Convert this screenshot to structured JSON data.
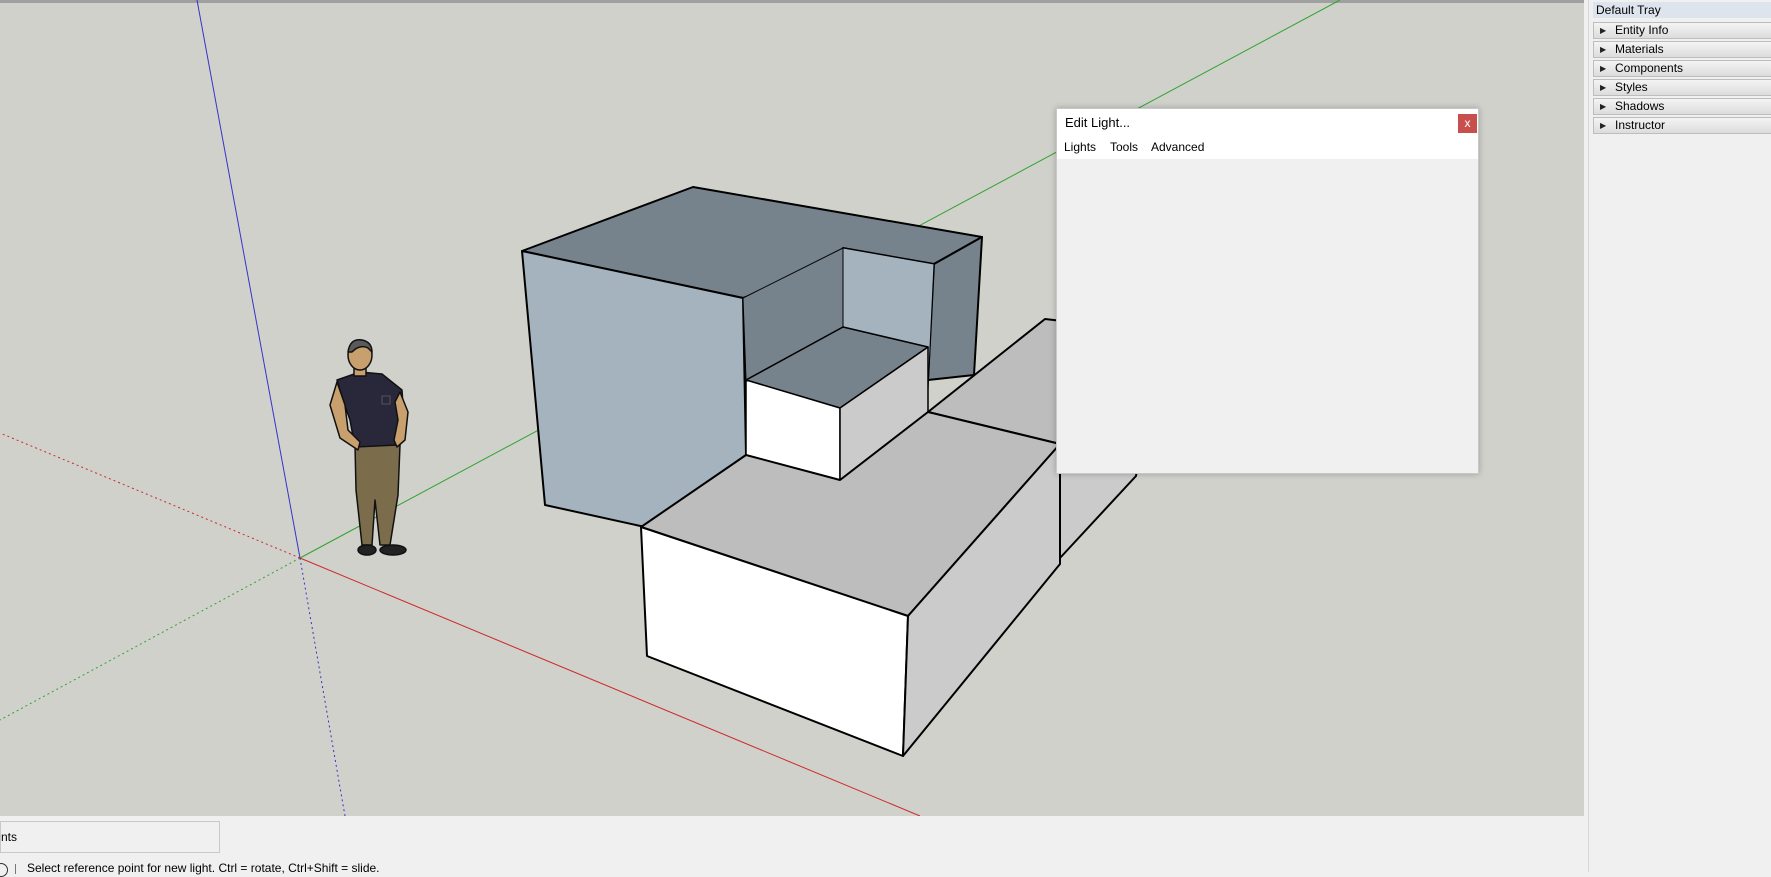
{
  "viewport": {
    "axes": {
      "blue": "#3434c8",
      "green": "#2fa32f",
      "red": "#cc2a2a"
    },
    "model_colors": {
      "top_dark": "#77838c",
      "side_blue": "#a4b3be",
      "white": "#ffffff",
      "gray_top": "#bdbdbd",
      "gray_side": "#cbcbcb"
    }
  },
  "dialog": {
    "title": "Edit Light...",
    "close_glyph": "x",
    "menu": [
      "Lights",
      "Tools",
      "Advanced"
    ]
  },
  "tray": {
    "title": "Default Tray",
    "panels": [
      "Entity Info",
      "Materials",
      "Components",
      "Styles",
      "Shadows",
      "Instructor"
    ]
  },
  "measurements": {
    "label": "nts",
    "value": ""
  },
  "status": {
    "text": "Select reference point for new light. Ctrl = rotate, Ctrl+Shift = slide."
  }
}
